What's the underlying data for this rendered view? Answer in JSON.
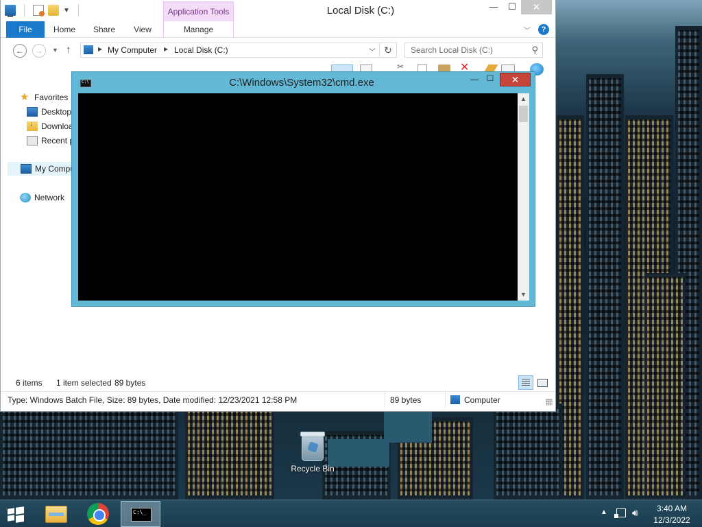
{
  "desktop": {
    "recycle_bin_label": "Recycle Bin"
  },
  "explorer": {
    "window_title": "Local Disk (C:)",
    "contextual_tab_group": "Application Tools",
    "controls": {
      "minimize": "—",
      "maximize": "☐",
      "close": "✕"
    },
    "ribbon_tabs": {
      "file": "File",
      "home": "Home",
      "share": "Share",
      "view": "View",
      "manage": "Manage"
    },
    "help": "?",
    "address": {
      "crumbs": [
        "My Computer",
        "Local Disk (C:)"
      ],
      "separator": "▶"
    },
    "search": {
      "placeholder": "Search Local Disk (C:)"
    },
    "nav_pane": {
      "favorites": "Favorites",
      "desktop": "Desktop",
      "downloads": "Downloads",
      "recent": "Recent places",
      "my_computer": "My Computer",
      "network": "Network"
    },
    "status": {
      "items": "6 items",
      "selected": "1 item selected",
      "size": "89 bytes"
    },
    "details_bar": {
      "info": "Type: Windows Batch File, Size: 89 bytes, Date modified: 12/23/2021 12:58 PM",
      "bytes": "89 bytes",
      "location": "Computer"
    }
  },
  "cmd": {
    "title": "C:\\Windows\\System32\\cmd.exe",
    "controls": {
      "minimize": "—",
      "maximize": "☐",
      "close": "✕"
    }
  },
  "taskbar": {
    "clock_time": "3:40 AM",
    "clock_date": "12/3/2022"
  },
  "colors": {
    "accent": "#1979ca",
    "cmd_frame": "#63b8d6",
    "cmd_close": "#c7443a",
    "app_tools": "#f2dcf8"
  }
}
